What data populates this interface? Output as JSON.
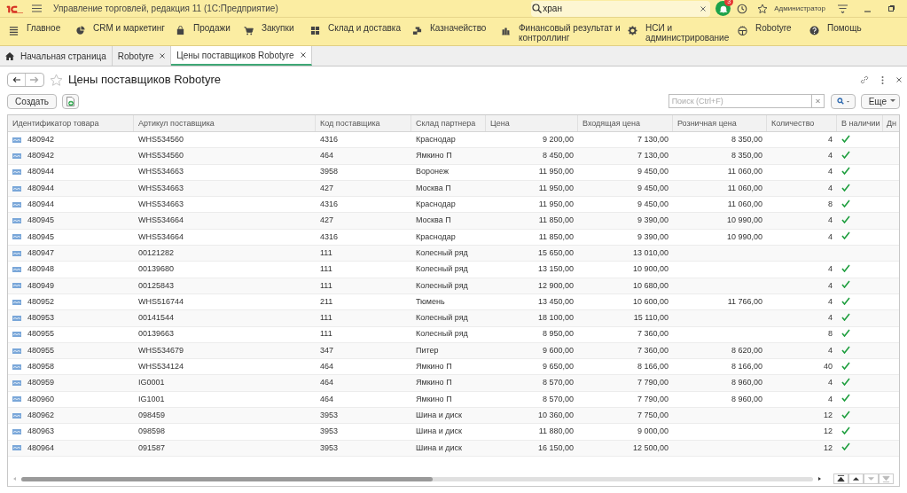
{
  "app_bar": {
    "title": "Управление торговлей, редакция 11  (1С:Предприятие)",
    "search_value": "хран",
    "notifications": "3",
    "user": "Администратор"
  },
  "sections": [
    {
      "label": "Главное"
    },
    {
      "label": "CRM и маркетинг"
    },
    {
      "label": "Продажи"
    },
    {
      "label": "Закупки"
    },
    {
      "label": "Склад и доставка"
    },
    {
      "label": "Казначейство"
    },
    {
      "label": "Финансовый результат и контроллинг"
    },
    {
      "label": "НСИ и администрирование"
    },
    {
      "label": "Robotyre"
    },
    {
      "label": "Помощь"
    }
  ],
  "tabs": [
    {
      "label": "Начальная страница",
      "kind": "home",
      "selected": false
    },
    {
      "label": "Robotyre",
      "kind": "page",
      "selected": false
    },
    {
      "label": "Цены поставщиков Robotyre",
      "kind": "page",
      "selected": true
    }
  ],
  "form": {
    "title": "Цены поставщиков Robotyre",
    "create_button": "Создать",
    "search_placeholder": "Поиск (Ctrl+F)",
    "more_button": "Еще"
  },
  "table": {
    "columns": [
      "Идентификатор товара",
      "Артикул поставщика",
      "Код поставщика",
      "Склад партнера",
      "Цена",
      "Входящая цена",
      "Розничная цена",
      "Количество",
      "В наличии",
      "Дн"
    ],
    "rows": [
      {
        "id": "480942",
        "article": "WHS534560",
        "code": "4316",
        "warehouse": "Краснодар",
        "price": "9 200,00",
        "incoming": "7 130,00",
        "retail": "8 350,00",
        "qty": "4",
        "in_stock": true
      },
      {
        "id": "480942",
        "article": "WHS534560",
        "code": "464",
        "warehouse": "Ямкино П",
        "price": "8 450,00",
        "incoming": "7 130,00",
        "retail": "8 350,00",
        "qty": "4",
        "in_stock": true
      },
      {
        "id": "480944",
        "article": "WHS534663",
        "code": "3958",
        "warehouse": "Воронеж",
        "price": "11 950,00",
        "incoming": "9 450,00",
        "retail": "11 060,00",
        "qty": "4",
        "in_stock": true
      },
      {
        "id": "480944",
        "article": "WHS534663",
        "code": "427",
        "warehouse": "Москва П",
        "price": "11 950,00",
        "incoming": "9 450,00",
        "retail": "11 060,00",
        "qty": "4",
        "in_stock": true
      },
      {
        "id": "480944",
        "article": "WHS534663",
        "code": "4316",
        "warehouse": "Краснодар",
        "price": "11 950,00",
        "incoming": "9 450,00",
        "retail": "11 060,00",
        "qty": "8",
        "in_stock": true
      },
      {
        "id": "480945",
        "article": "WHS534664",
        "code": "427",
        "warehouse": "Москва П",
        "price": "11 850,00",
        "incoming": "9 390,00",
        "retail": "10 990,00",
        "qty": "4",
        "in_stock": true
      },
      {
        "id": "480945",
        "article": "WHS534664",
        "code": "4316",
        "warehouse": "Краснодар",
        "price": "11 850,00",
        "incoming": "9 390,00",
        "retail": "10 990,00",
        "qty": "4",
        "in_stock": true
      },
      {
        "id": "480947",
        "article": "00121282",
        "code": "111",
        "warehouse": "Колесный ряд",
        "price": "15 650,00",
        "incoming": "13 010,00",
        "in_stock": false
      },
      {
        "id": "480948",
        "article": "00139680",
        "code": "111",
        "warehouse": "Колесный ряд",
        "price": "13 150,00",
        "incoming": "10 900,00",
        "qty": "4",
        "in_stock": true
      },
      {
        "id": "480949",
        "article": "00125843",
        "code": "111",
        "warehouse": "Колесный ряд",
        "price": "12 900,00",
        "incoming": "10 680,00",
        "qty": "4",
        "in_stock": true
      },
      {
        "id": "480952",
        "article": "WHS516744",
        "code": "211",
        "warehouse": "Тюмень",
        "price": "13 450,00",
        "incoming": "10 600,00",
        "retail": "11 766,00",
        "qty": "4",
        "in_stock": true
      },
      {
        "id": "480953",
        "article": "00141544",
        "code": "111",
        "warehouse": "Колесный ряд",
        "price": "18 100,00",
        "incoming": "15 110,00",
        "qty": "4",
        "in_stock": true
      },
      {
        "id": "480955",
        "article": "00139663",
        "code": "111",
        "warehouse": "Колесный ряд",
        "price": "8 950,00",
        "incoming": "7 360,00",
        "qty": "8",
        "in_stock": true
      },
      {
        "id": "480955",
        "article": "WHS534679",
        "code": "347",
        "warehouse": "Питер",
        "price": "9 600,00",
        "incoming": "7 360,00",
        "retail": "8 620,00",
        "qty": "4",
        "in_stock": true
      },
      {
        "id": "480958",
        "article": "WHS534124",
        "code": "464",
        "warehouse": "Ямкино П",
        "price": "9 650,00",
        "incoming": "8 166,00",
        "retail": "8 166,00",
        "qty": "40",
        "in_stock": true
      },
      {
        "id": "480959",
        "article": "IG0001",
        "code": "464",
        "warehouse": "Ямкино П",
        "price": "8 570,00",
        "incoming": "7 790,00",
        "retail": "8 960,00",
        "qty": "4",
        "in_stock": true
      },
      {
        "id": "480960",
        "article": "IG1001",
        "code": "464",
        "warehouse": "Ямкино П",
        "price": "8 570,00",
        "incoming": "7 790,00",
        "retail": "8 960,00",
        "qty": "4",
        "in_stock": true
      },
      {
        "id": "480962",
        "article": "098459",
        "code": "3953",
        "warehouse": "Шина и диск",
        "price": "10 360,00",
        "incoming": "7 750,00",
        "qty": "12",
        "in_stock": true
      },
      {
        "id": "480963",
        "article": "098598",
        "code": "3953",
        "warehouse": "Шина и диск",
        "price": "11 880,00",
        "incoming": "9 000,00",
        "qty": "12",
        "in_stock": true
      },
      {
        "id": "480964",
        "article": "091587",
        "code": "3953",
        "warehouse": "Шина и диск",
        "price": "16 150,00",
        "incoming": "12 500,00",
        "qty": "12",
        "in_stock": true
      }
    ]
  }
}
